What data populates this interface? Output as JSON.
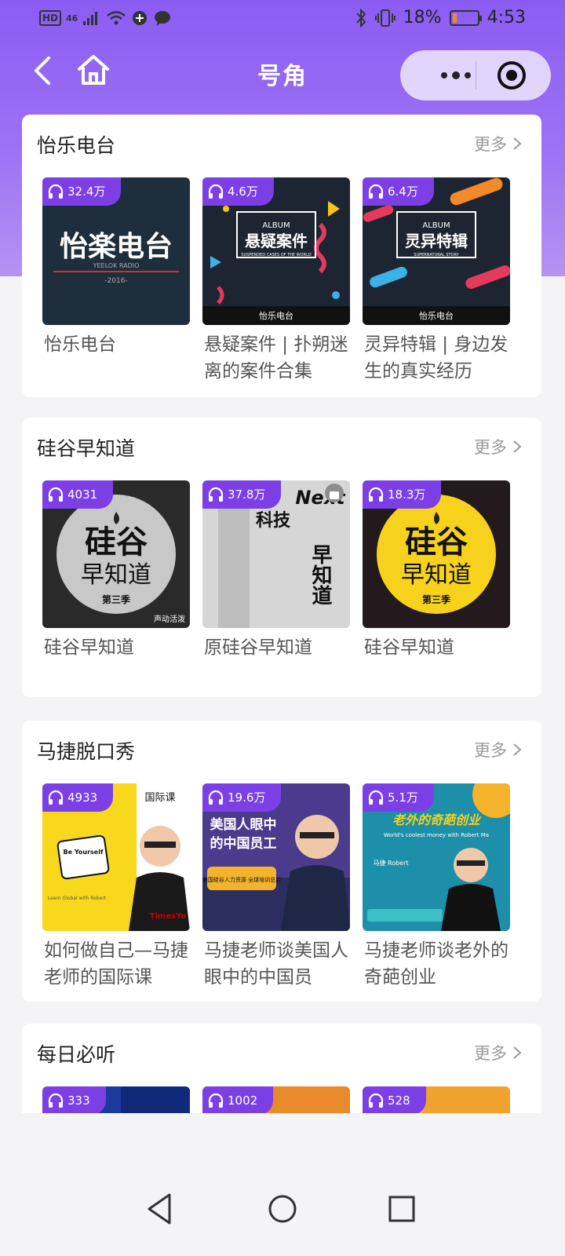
{
  "status_bar": {
    "hd": "HD",
    "signal": "46",
    "battery": "18%",
    "time": "4:53"
  },
  "nav": {
    "title": "号角"
  },
  "colors": {
    "header_gradient_top": "#8b5cf3",
    "badge": "#7c3fe6",
    "background": "#f4f4f6"
  },
  "sections": [
    {
      "title": "怡乐电台",
      "more": "更多",
      "items": [
        {
          "plays": "32.4万",
          "title": "怡乐电台",
          "cover_text": "怡楽电台",
          "cover_sub": "YEELOK RADIO",
          "cover_year": "-2016-",
          "cover_bg": "#1e2c3a"
        },
        {
          "plays": "4.6万",
          "title": "悬疑案件 | 扑朔迷离的案件合集",
          "cover_text": "悬疑案件",
          "cover_label": "ALBUM",
          "cover_sub": "SUSPENDED CASES OF THE WORLD",
          "cover_footer": "怡乐电台",
          "cover_bg": "#1d2430"
        },
        {
          "plays": "6.4万",
          "title": "灵异特辑 | 身边发生的真实经历",
          "cover_text": "灵异特辑",
          "cover_label": "ALBUM",
          "cover_sub": "SUPERNATURAL STORY",
          "cover_footer": "怡乐电台",
          "cover_bg": "#1d2430"
        }
      ]
    },
    {
      "title": "硅谷早知道",
      "more": "更多",
      "items": [
        {
          "plays": "4031",
          "title": "硅谷早知道",
          "cover_text": "硅谷",
          "cover_text2": "早知道",
          "cover_season": "第三季",
          "cover_logo": "声动活泼",
          "cover_bg": "#2a2a2a"
        },
        {
          "plays": "37.8万",
          "title": "原硅谷早知道",
          "cover_text": "科技",
          "cover_text2": "早知道",
          "cover_label": "Next",
          "cover_bg": "#d8d8d8"
        },
        {
          "plays": "18.3万",
          "title": "硅谷早知道",
          "cover_text": "硅谷",
          "cover_text2": "早知道",
          "cover_season": "第三季",
          "cover_bg": "#231a1e"
        }
      ]
    },
    {
      "title": "马捷脱口秀",
      "more": "更多",
      "items": [
        {
          "plays": "4933",
          "title": "如何做自己—马捷老师的国际课",
          "cover_text": "国际课",
          "cover_bubble": "Be Yourself",
          "cover_brand": "TimesYo",
          "cover_caption": "Learn Global with Robert",
          "cover_bg": "#f7d81c"
        },
        {
          "plays": "19.6万",
          "title": "马捷老师谈美国人眼中的中国员",
          "cover_text": "美国人眼中",
          "cover_text2": "的中国员工",
          "cover_tag": "美国硅谷人力资源 全球培训总监",
          "cover_bg": "#4a3b8c"
        },
        {
          "plays": "5.1万",
          "title": "马捷老师谈老外的奇葩创业",
          "cover_text": "老外的奇葩创业",
          "cover_sub": "World's coolest money with Robert Ma",
          "cover_name": "马捷 Robert",
          "cover_bg": "#1e8fa8"
        }
      ]
    },
    {
      "title": "每日必听",
      "more": "更多",
      "items": [
        {
          "plays": "333",
          "cover_bg": "#1a3aa0"
        },
        {
          "plays": "1002",
          "cover_bg": "#e8892a"
        },
        {
          "plays": "528",
          "cover_bg": "#f0a22e"
        }
      ]
    }
  ]
}
